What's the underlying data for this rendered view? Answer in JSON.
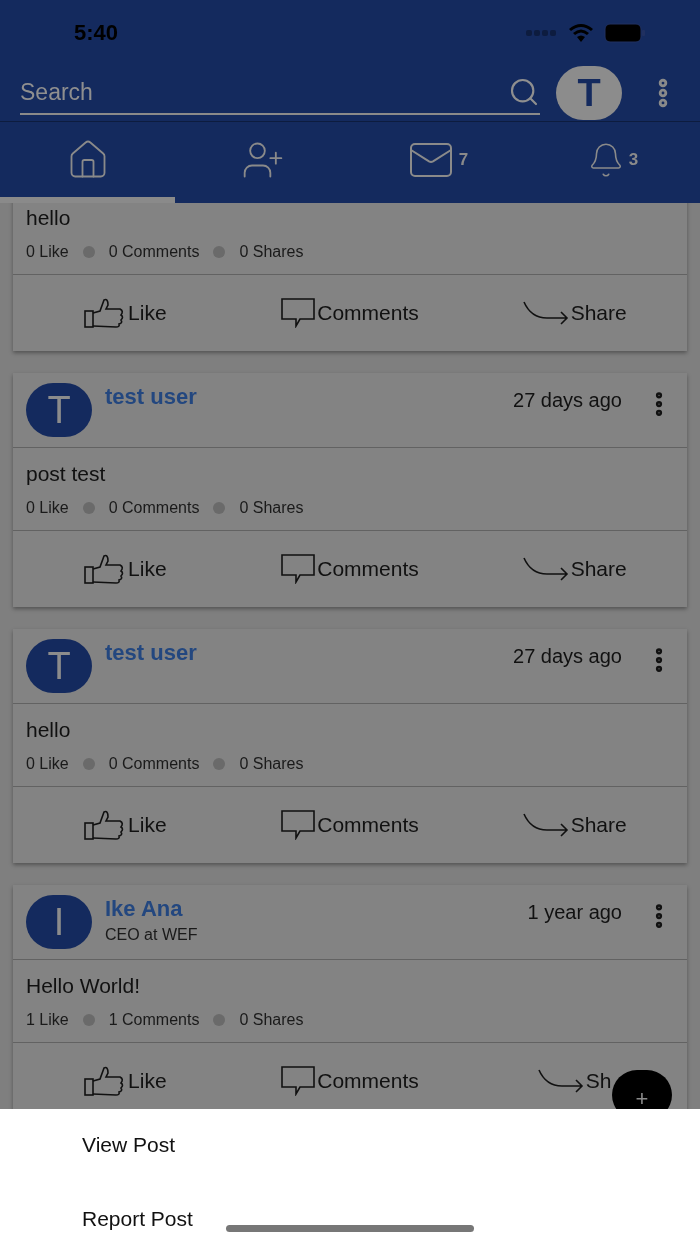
{
  "status_bar": {
    "time": "5:40"
  },
  "search": {
    "placeholder": "Search",
    "avatar_letter": "T"
  },
  "nav_tabs": [
    {
      "kind": "home",
      "selected": true
    },
    {
      "kind": "add_friend",
      "selected": false
    },
    {
      "kind": "messages",
      "badge": "7",
      "selected": false
    },
    {
      "kind": "notifications",
      "badge": "3",
      "selected": false
    }
  ],
  "posts": [
    {
      "text": "hello",
      "stats": [
        "0 Like",
        "0 Comments",
        "0 Shares"
      ],
      "actions": [
        "Like",
        "Comments",
        "Share"
      ]
    },
    {
      "avatar_letter": "T",
      "author": "test user",
      "time": "27 days ago",
      "text": "post test",
      "stats": [
        "0 Like",
        "0 Comments",
        "0 Shares"
      ],
      "actions": [
        "Like",
        "Comments",
        "Share"
      ]
    },
    {
      "avatar_letter": "T",
      "author": "test user",
      "time": "27 days ago",
      "text": "hello",
      "stats": [
        "0 Like",
        "0 Comments",
        "0 Shares"
      ],
      "actions": [
        "Like",
        "Comments",
        "Share"
      ]
    },
    {
      "avatar_letter": "I",
      "author": "Ike Ana",
      "subtitle": "CEO at WEF",
      "time": "1 year ago",
      "text": "Hello World!",
      "stats": [
        "1 Like",
        "1 Comments",
        "0 Shares"
      ],
      "actions": [
        "Like",
        "Comments",
        "Sh"
      ]
    }
  ],
  "fab": {
    "label": "+"
  },
  "sheet": {
    "options": [
      "View Post",
      "Report Post"
    ]
  }
}
